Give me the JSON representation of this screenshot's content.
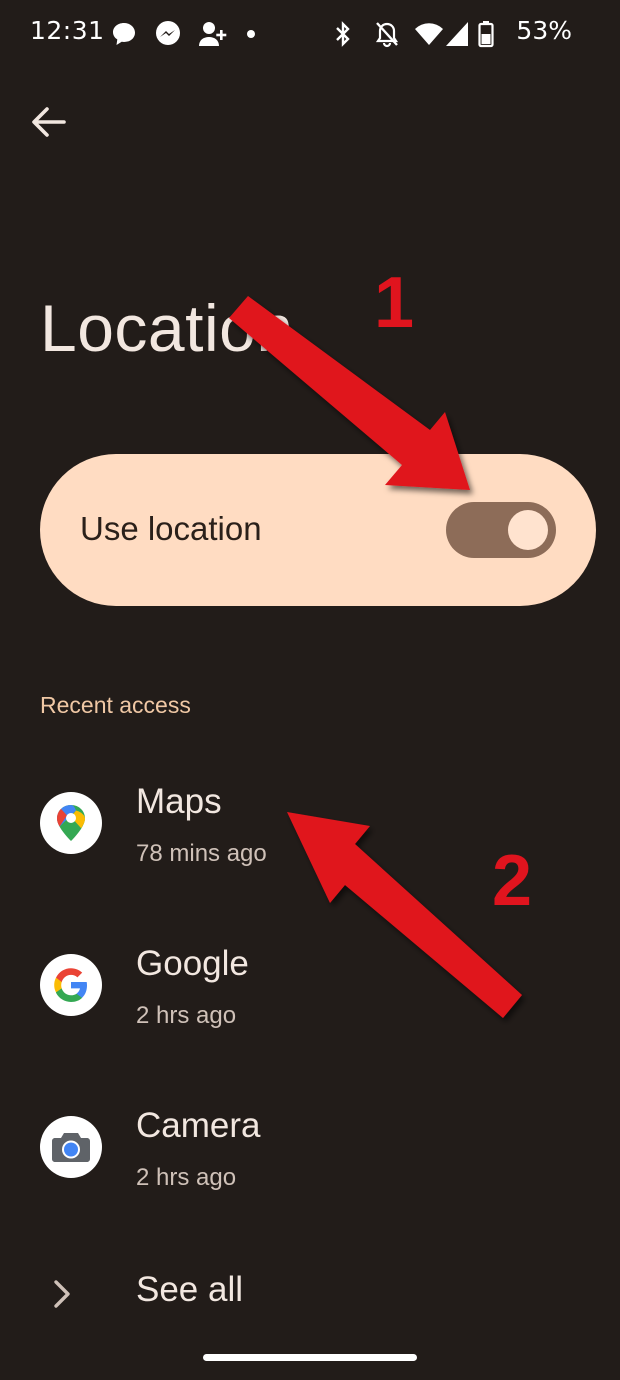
{
  "status_bar": {
    "time": "12:31",
    "battery_percent": "53%",
    "left_icons": [
      "chat-icon",
      "messenger-icon",
      "add-person-icon",
      "dot-icon"
    ],
    "right_icons": [
      "bluetooth-icon",
      "mute-icon",
      "wifi-icon",
      "signal-icon",
      "battery-icon"
    ]
  },
  "page": {
    "title": "Location"
  },
  "use_location": {
    "label": "Use location",
    "enabled": true
  },
  "recent_access": {
    "header": "Recent access",
    "items": [
      {
        "name": "Maps",
        "time": "78 mins ago",
        "icon": "google-maps-icon"
      },
      {
        "name": "Google",
        "time": "2 hrs ago",
        "icon": "google-icon"
      },
      {
        "name": "Camera",
        "time": "2 hrs ago",
        "icon": "camera-icon"
      }
    ]
  },
  "see_all": {
    "label": "See all"
  },
  "annotations": {
    "step_1": "1",
    "step_2": "2"
  },
  "colors": {
    "background": "#221c19",
    "card": "#ffdcc2",
    "toggle_track": "#8d6c58",
    "accent_header": "#f0c8a5",
    "annotation_red": "#e0141e"
  }
}
